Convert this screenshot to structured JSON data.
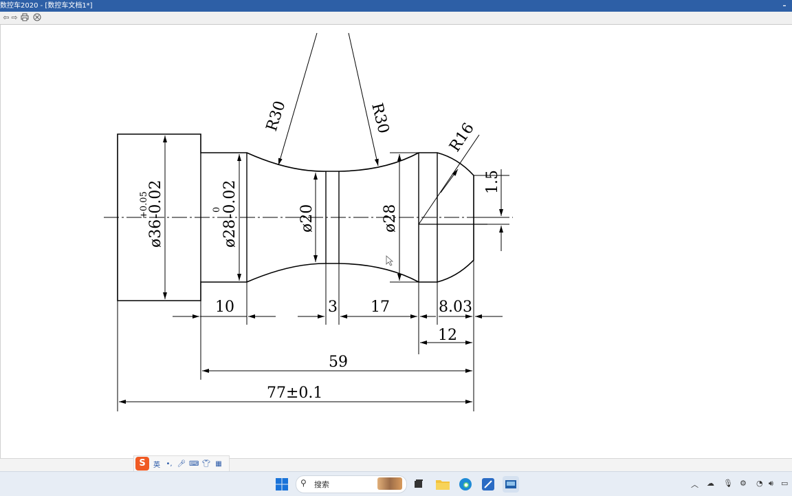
{
  "window": {
    "title": "数控车2020 - [数控车文档1*]",
    "minimize_glyph": "–"
  },
  "toolbar": {
    "icons": [
      "back-arrow-icon",
      "forward-arrow-icon",
      "print-icon",
      "close-doc-icon"
    ]
  },
  "drawing": {
    "dimensions": {
      "dia_outer": "ø36",
      "dia_outer_tol_upper": "+0.05",
      "dia_outer_tol_lower": "-0.02",
      "dia_second": "ø28",
      "dia_second_tol_upper": "0",
      "dia_second_tol_lower": "-0.02",
      "dia_neck": "ø20",
      "dia_right": "ø28",
      "radius_left": "R30",
      "radius_right": "R30",
      "radius_end": "R16",
      "offset": "1.5",
      "len_10": "10",
      "len_3": "3",
      "len_17": "17",
      "len_803": "8.03",
      "len_12": "12",
      "len_59": "59",
      "len_total": "77±0.1"
    }
  },
  "ime": {
    "logo": "S",
    "lang": "英",
    "items": [
      "punctuation-icon",
      "microphone-icon",
      "keyboard-icon",
      "skin-icon",
      "toolbox-icon"
    ]
  },
  "taskbar": {
    "search_placeholder": "搜索",
    "apps": [
      "windows-start-icon",
      "task-view-icon",
      "file-explorer-icon",
      "edge-browser-icon",
      "cad-app-icon",
      "cnc-app-icon"
    ],
    "tray": [
      "chevron-up-icon",
      "cloud-icon",
      "keyboard-icon",
      "mic-icon",
      "settings-icon",
      "wifi-icon",
      "volume-icon",
      "battery-icon"
    ]
  }
}
